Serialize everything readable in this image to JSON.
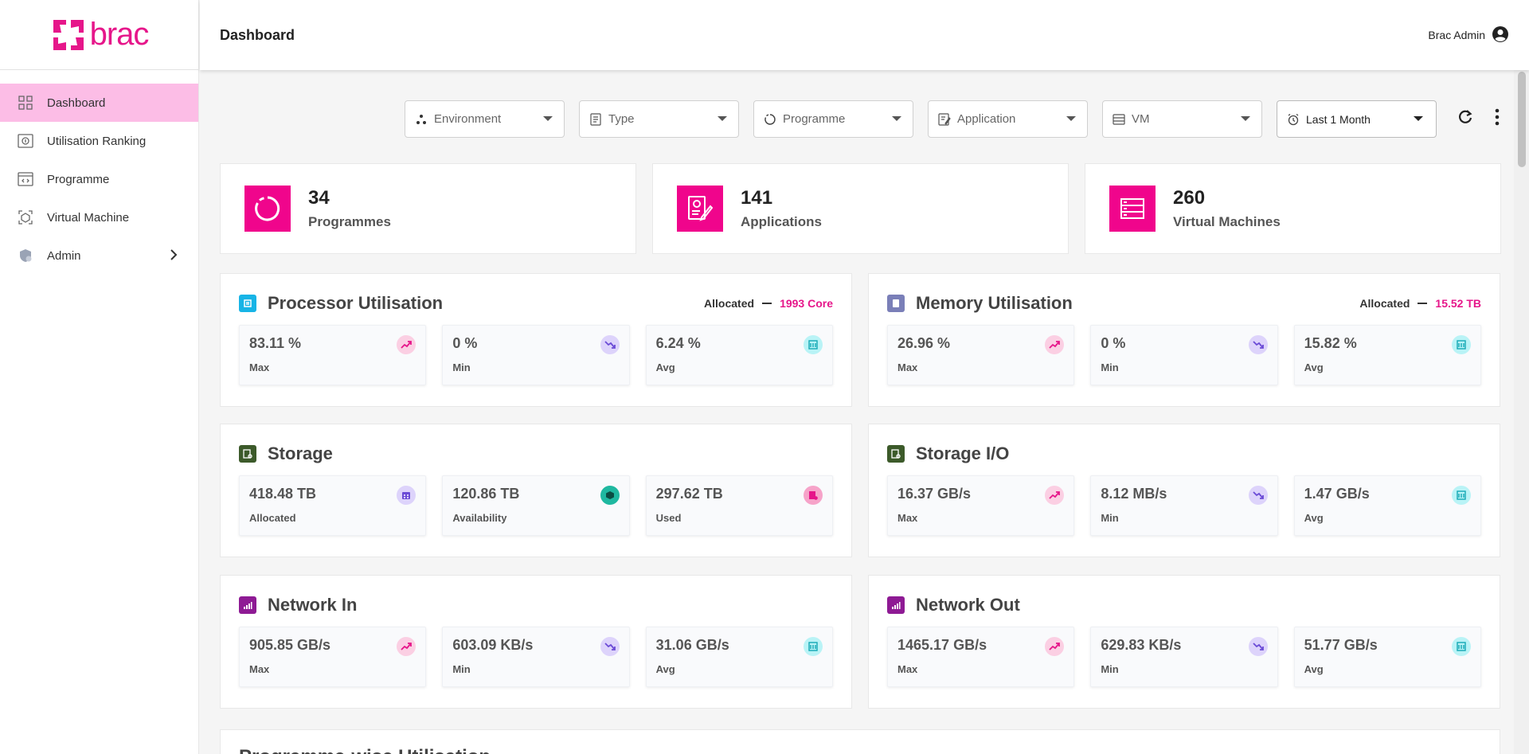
{
  "brand": {
    "logo_text": "brac",
    "accent": "#e6168a"
  },
  "sidebar": {
    "items": [
      {
        "label": "Dashboard",
        "icon": "grid-icon",
        "active": true
      },
      {
        "label": "Utilisation Ranking",
        "icon": "ranking-icon"
      },
      {
        "label": "Programme",
        "icon": "code-window-icon"
      },
      {
        "label": "Virtual Machine",
        "icon": "vm-icon"
      },
      {
        "label": "Admin",
        "icon": "admin-icon",
        "has_submenu": true
      }
    ]
  },
  "header": {
    "title": "Dashboard",
    "user_name": "Brac Admin"
  },
  "filters": {
    "environment": "Environment",
    "type": "Type",
    "programme": "Programme",
    "application": "Application",
    "vm": "VM",
    "time_range": "Last 1 Month"
  },
  "stats": [
    {
      "value": "34",
      "label": "Programmes"
    },
    {
      "value": "141",
      "label": "Applications"
    },
    {
      "value": "260",
      "label": "Virtual Machines"
    }
  ],
  "processor": {
    "title": "Processor Utilisation",
    "allocated_label": "Allocated",
    "allocated_value": "1993 Core",
    "tiles": [
      {
        "value": "83.11 %",
        "label": "Max"
      },
      {
        "value": "0 %",
        "label": "Min"
      },
      {
        "value": "6.24 %",
        "label": "Avg"
      }
    ]
  },
  "memory": {
    "title": "Memory Utilisation",
    "allocated_label": "Allocated",
    "allocated_value": "15.52 TB",
    "tiles": [
      {
        "value": "26.96 %",
        "label": "Max"
      },
      {
        "value": "0 %",
        "label": "Min"
      },
      {
        "value": "15.82 %",
        "label": "Avg"
      }
    ]
  },
  "storage": {
    "title": "Storage",
    "tiles": [
      {
        "value": "418.48 TB",
        "label": "Allocated"
      },
      {
        "value": "120.86 TB",
        "label": "Availability"
      },
      {
        "value": "297.62 TB",
        "label": "Used"
      }
    ]
  },
  "storage_io": {
    "title": "Storage I/O",
    "tiles": [
      {
        "value": "16.37 GB/s",
        "label": "Max"
      },
      {
        "value": "8.12 MB/s",
        "label": "Min"
      },
      {
        "value": "1.47 GB/s",
        "label": "Avg"
      }
    ]
  },
  "network_in": {
    "title": "Network In",
    "tiles": [
      {
        "value": "905.85 GB/s",
        "label": "Max"
      },
      {
        "value": "603.09 KB/s",
        "label": "Min"
      },
      {
        "value": "31.06 GB/s",
        "label": "Avg"
      }
    ]
  },
  "network_out": {
    "title": "Network Out",
    "tiles": [
      {
        "value": "1465.17 GB/s",
        "label": "Max"
      },
      {
        "value": "629.83 KB/s",
        "label": "Min"
      },
      {
        "value": "51.77 GB/s",
        "label": "Avg"
      }
    ]
  },
  "next_section": {
    "title": "Programme-wise Utilisation"
  }
}
